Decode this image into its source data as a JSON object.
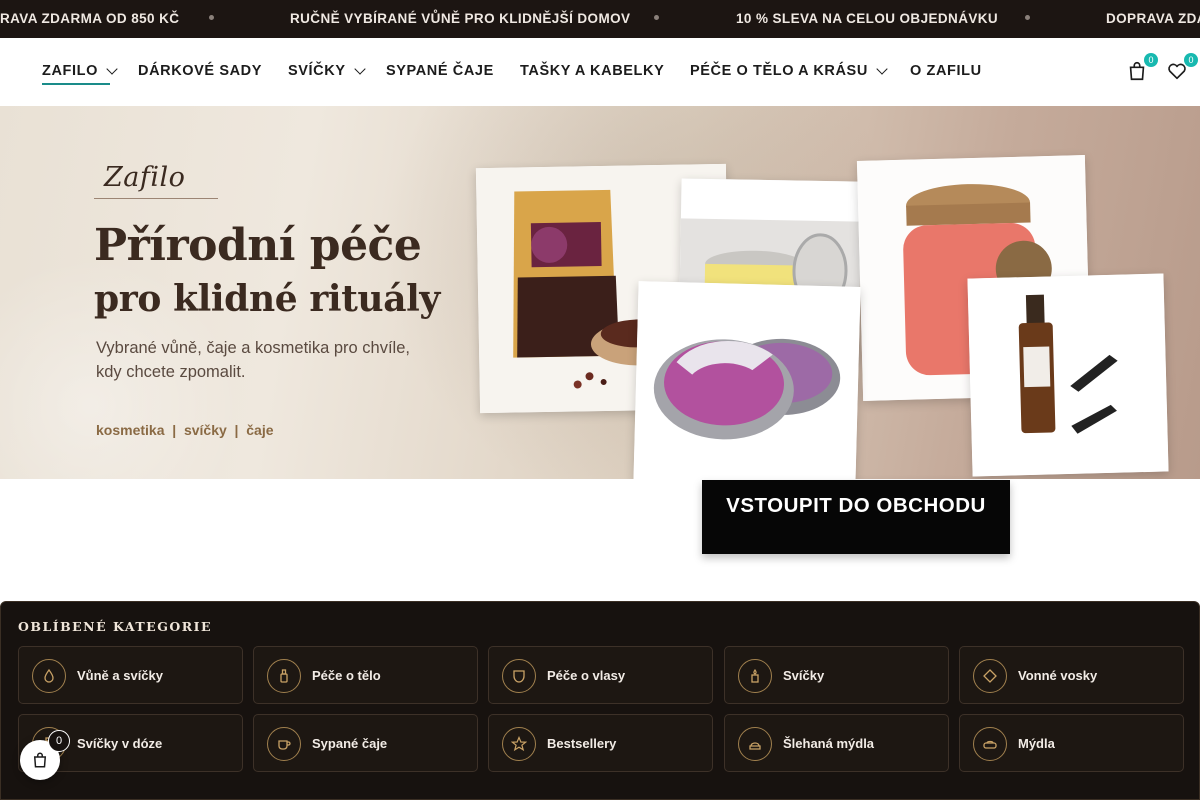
{
  "announcement": {
    "messages": [
      "RAVA ZDARMA OD 850 KČ",
      "RUČNĚ VYBÍRANÉ VŮNĚ PRO KLIDNĚJŠÍ DOMOV",
      "10 % SLEVA NA CELOU OBJEDNÁVKU",
      "DOPRAVA ZDARMA"
    ]
  },
  "nav": {
    "items": [
      {
        "label": "ZAFILO"
      },
      {
        "label": "DÁRKOVÉ SADY"
      },
      {
        "label": "SVÍČKY"
      },
      {
        "label": "SYPANÉ ČAJE"
      },
      {
        "label": "TAŠKY A KABELKY"
      },
      {
        "label": "PÉČE O TĚLO A KRÁSU"
      },
      {
        "label": "O ZAFILU"
      }
    ],
    "cart_count": "0",
    "wishlist_count": "0"
  },
  "hero": {
    "brand": "Zafilo",
    "title_line1": "Přírodní péče",
    "title_line2": "pro klidné rituály",
    "subtitle": "Vybrané vůně, čaje a kosmetika pro chvíle, kdy chcete zpomalit.",
    "tags": "kosmetika  |  svíčky  |  čaje"
  },
  "cta": {
    "label": "VSTOUPIT DO OBCHODU"
  },
  "categories": {
    "title": "OBLÍBENÉ KATEGORIE",
    "items": [
      {
        "label": "Vůně a svíčky",
        "icon": "drop-icon"
      },
      {
        "label": "Péče o tělo",
        "icon": "bottle-icon"
      },
      {
        "label": "Péče o vlasy",
        "icon": "shield-face-icon"
      },
      {
        "label": "Svíčky",
        "icon": "candle-icon"
      },
      {
        "label": "Vonné vosky",
        "icon": "diamond-icon"
      },
      {
        "label": "Svíčky v dóze",
        "icon": "jar-icon"
      },
      {
        "label": "Sypané čaje",
        "icon": "cup-icon"
      },
      {
        "label": "Bestsellery",
        "icon": "star-icon"
      },
      {
        "label": "Šlehaná mýdla",
        "icon": "soap-icon"
      },
      {
        "label": "Mýdla",
        "icon": "bar-soap-icon"
      }
    ]
  },
  "floating_cart": {
    "count": "0"
  },
  "colors": {
    "accent": "#18b9b0",
    "dark": "#17120f",
    "gold": "#a0804e"
  }
}
